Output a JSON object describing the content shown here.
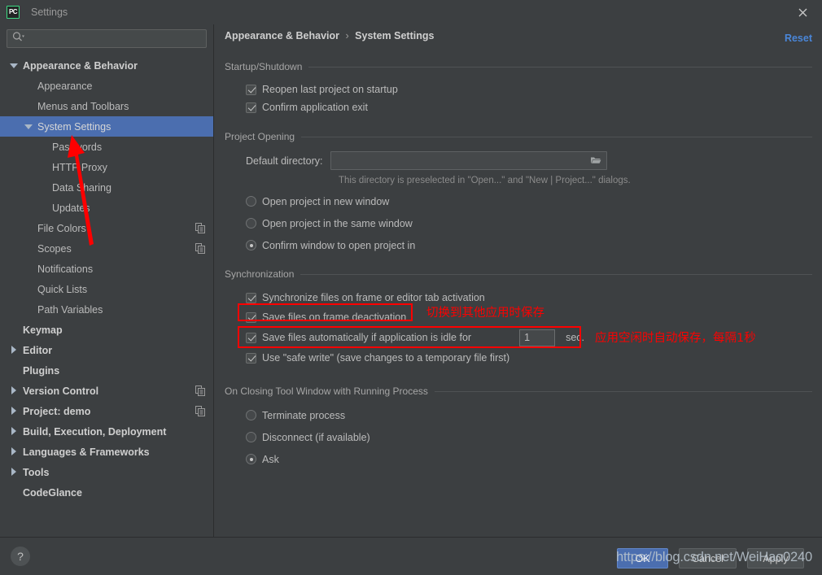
{
  "window": {
    "title": "Settings",
    "app_icon": "pycharm-icon",
    "close_icon": "close-icon"
  },
  "search": {
    "placeholder": "",
    "value": "",
    "icon": "search-icon"
  },
  "sidebar": {
    "items": [
      {
        "label": "Appearance & Behavior",
        "indent": 0,
        "arrow": "down",
        "bold": true,
        "selected": false,
        "badge": ""
      },
      {
        "label": "Appearance",
        "indent": 1,
        "arrow": "none",
        "bold": false,
        "selected": false,
        "badge": ""
      },
      {
        "label": "Menus and Toolbars",
        "indent": 1,
        "arrow": "none",
        "bold": false,
        "selected": false,
        "badge": ""
      },
      {
        "label": "System Settings",
        "indent": 1,
        "arrow": "down",
        "bold": false,
        "selected": true,
        "badge": ""
      },
      {
        "label": "Passwords",
        "indent": 2,
        "arrow": "none",
        "bold": false,
        "selected": false,
        "badge": ""
      },
      {
        "label": "HTTP Proxy",
        "indent": 2,
        "arrow": "none",
        "bold": false,
        "selected": false,
        "badge": ""
      },
      {
        "label": "Data Sharing",
        "indent": 2,
        "arrow": "none",
        "bold": false,
        "selected": false,
        "badge": ""
      },
      {
        "label": "Updates",
        "indent": 2,
        "arrow": "none",
        "bold": false,
        "selected": false,
        "badge": ""
      },
      {
        "label": "File Colors",
        "indent": 1,
        "arrow": "none",
        "bold": false,
        "selected": false,
        "badge": "copy-icon"
      },
      {
        "label": "Scopes",
        "indent": 1,
        "arrow": "none",
        "bold": false,
        "selected": false,
        "badge": "copy-icon"
      },
      {
        "label": "Notifications",
        "indent": 1,
        "arrow": "none",
        "bold": false,
        "selected": false,
        "badge": ""
      },
      {
        "label": "Quick Lists",
        "indent": 1,
        "arrow": "none",
        "bold": false,
        "selected": false,
        "badge": ""
      },
      {
        "label": "Path Variables",
        "indent": 1,
        "arrow": "none",
        "bold": false,
        "selected": false,
        "badge": ""
      },
      {
        "label": "Keymap",
        "indent": 0,
        "arrow": "none",
        "bold": true,
        "selected": false,
        "badge": ""
      },
      {
        "label": "Editor",
        "indent": 0,
        "arrow": "right",
        "bold": true,
        "selected": false,
        "badge": ""
      },
      {
        "label": "Plugins",
        "indent": 0,
        "arrow": "none",
        "bold": true,
        "selected": false,
        "badge": ""
      },
      {
        "label": "Version Control",
        "indent": 0,
        "arrow": "right",
        "bold": true,
        "selected": false,
        "badge": "copy-icon"
      },
      {
        "label": "Project: demo",
        "indent": 0,
        "arrow": "right",
        "bold": true,
        "selected": false,
        "badge": "copy-icon"
      },
      {
        "label": "Build, Execution, Deployment",
        "indent": 0,
        "arrow": "right",
        "bold": true,
        "selected": false,
        "badge": ""
      },
      {
        "label": "Languages & Frameworks",
        "indent": 0,
        "arrow": "right",
        "bold": true,
        "selected": false,
        "badge": ""
      },
      {
        "label": "Tools",
        "indent": 0,
        "arrow": "right",
        "bold": true,
        "selected": false,
        "badge": ""
      },
      {
        "label": "CodeGlance",
        "indent": 0,
        "arrow": "none",
        "bold": true,
        "selected": false,
        "badge": ""
      }
    ]
  },
  "breadcrumb": {
    "parent": "Appearance & Behavior",
    "separator": "›",
    "current": "System Settings"
  },
  "reset_label": "Reset",
  "main": {
    "startup_shutdown": {
      "title": "Startup/Shutdown",
      "options": [
        {
          "label": "Reopen last project on startup",
          "checked": true
        },
        {
          "label": "Confirm application exit",
          "checked": true
        }
      ]
    },
    "project_opening": {
      "title": "Project Opening",
      "directory_label": "Default directory:",
      "directory_value": "",
      "browse_icon": "folder-icon",
      "hint": "This directory is preselected in \"Open...\" and \"New | Project...\" dialogs.",
      "radios": [
        {
          "label": "Open project in new window",
          "selected": false
        },
        {
          "label": "Open project in the same window",
          "selected": false
        },
        {
          "label": "Confirm window to open project in",
          "selected": true
        }
      ]
    },
    "synchronization": {
      "title": "Synchronization",
      "options": [
        {
          "label": "Synchronize files on frame or editor tab activation",
          "checked": true
        },
        {
          "label": "Save files on frame deactivation",
          "checked": true
        },
        {
          "label": "Save files automatically if application is idle for",
          "checked": true
        },
        {
          "label": "Use \"safe write\" (save changes to a temporary file first)",
          "checked": true
        }
      ],
      "idle_value": "1",
      "idle_unit": "sec."
    },
    "closing_tool_window": {
      "title": "On Closing Tool Window with Running Process",
      "radios": [
        {
          "label": "Terminate process",
          "selected": false
        },
        {
          "label": "Disconnect (if available)",
          "selected": false
        },
        {
          "label": "Ask",
          "selected": true
        }
      ]
    }
  },
  "annotations": {
    "color": "#fe0000",
    "note_frame_deactivation": "切换到其他应用时保存",
    "note_idle_autosave": "应用空闲时自动保存，每隔1秒"
  },
  "footer": {
    "help_icon": "question-mark-icon",
    "ok_label": "OK",
    "cancel_label": "Cancel",
    "apply_label": "Apply",
    "watermark": "https://blog.csdn.net/WeiHao0240"
  },
  "colors": {
    "background": "#3c3f41",
    "selection": "#4b6eaf",
    "accent_link": "#4a86d8",
    "annotation": "#fe0000",
    "text": "#bbbbbb"
  }
}
